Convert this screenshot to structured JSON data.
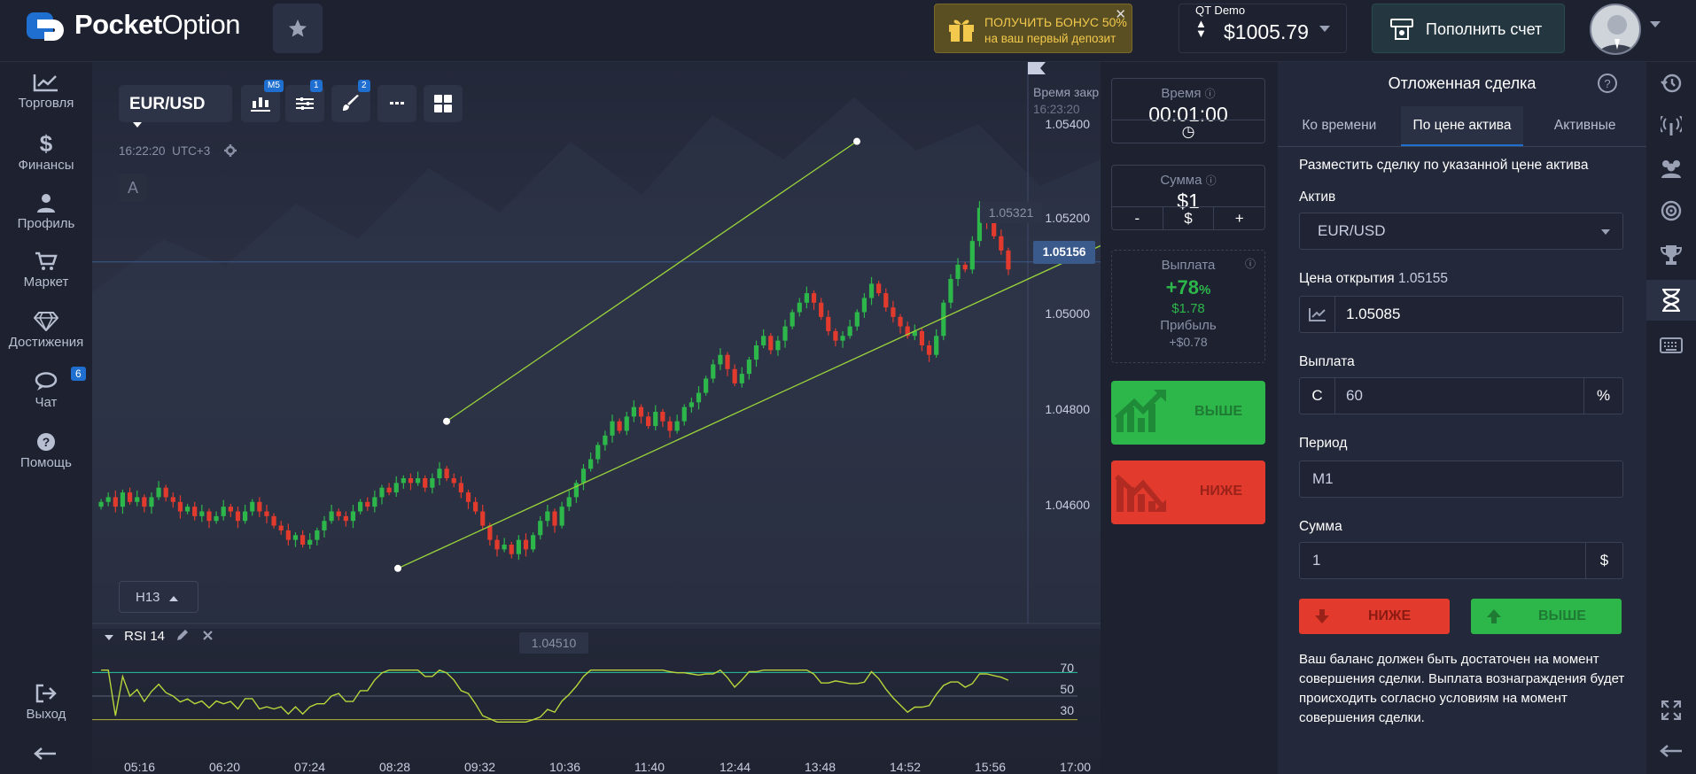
{
  "header": {
    "logo_bold": "Pocket",
    "logo_rest": "Option",
    "bonus_line1": "ПОЛУЧИТЬ БОНУС 50%",
    "bonus_line2": "на ваш первый депозит",
    "bonus_close": "✕",
    "account_type": "QT Demo",
    "balance": "$1005.79",
    "deposit_label": "Пополнить счет"
  },
  "sidebar": {
    "items": [
      {
        "label": "Торговля",
        "icon": "chart-line-icon"
      },
      {
        "label": "Финансы",
        "icon": "dollar-icon"
      },
      {
        "label": "Профиль",
        "icon": "user-icon"
      },
      {
        "label": "Маркет",
        "icon": "cart-icon"
      },
      {
        "label": "Достижения",
        "icon": "diamond-icon"
      },
      {
        "label": "Чат",
        "icon": "chat-icon",
        "badge": "6"
      },
      {
        "label": "Помощь",
        "icon": "help-icon"
      }
    ],
    "logout": "Выход"
  },
  "chart": {
    "pair": "EUR/USD",
    "timeframe_badge": "M5",
    "indicators_badge": "1",
    "drawings_badge": "2",
    "clock": "16:22:20",
    "timezone": "UTC+3",
    "a_label": "A",
    "expiry_label": "Время закр",
    "expiry_time": "16:23:20",
    "current_price": "1.05156",
    "channel_top_label": "1.05321",
    "channel_bottom_label": "1.04510",
    "price_ticks": [
      "1.05400",
      "1.05200",
      "1.05000",
      "1.04800",
      "1.04600"
    ],
    "time_ticks": [
      "05:16",
      "06:20",
      "07:24",
      "08:28",
      "09:32",
      "10:36",
      "11:40",
      "12:44",
      "13:48",
      "14:52",
      "15:56",
      "17:00"
    ],
    "period_selector": "H13",
    "rsi_label": "RSI 14",
    "rsi_levels": [
      "70",
      "50",
      "30"
    ],
    "colors": {
      "up": "#2db74b",
      "down": "#e23b2e",
      "channel": "#9ad53a",
      "rsi_line": "#b7d63b",
      "rsi_level_high": "#28c5a0",
      "rsi_level_low": "#b7b43b"
    }
  },
  "chart_data": {
    "type": "candlestick",
    "pair": "EUR/USD",
    "time_axis": [
      "05:16",
      "06:20",
      "07:24",
      "08:28",
      "09:32",
      "10:36",
      "11:40",
      "12:44",
      "13:48",
      "14:52",
      "15:56",
      "17:00"
    ],
    "price_axis": [
      1.046,
      1.048,
      1.05,
      1.052,
      1.054
    ],
    "ylim": [
      1.0442,
      1.0554
    ],
    "current_price": 1.05156,
    "closes": [
      1.0465,
      1.0466,
      1.0464,
      1.0467,
      1.0465,
      1.0466,
      1.0464,
      1.0466,
      1.0468,
      1.0466,
      1.0465,
      1.0463,
      1.0464,
      1.0462,
      1.0463,
      1.0461,
      1.0462,
      1.0464,
      1.0463,
      1.0461,
      1.0463,
      1.0465,
      1.0463,
      1.0462,
      1.046,
      1.0459,
      1.0457,
      1.0458,
      1.0456,
      1.0457,
      1.0459,
      1.0461,
      1.0463,
      1.0462,
      1.0461,
      1.0463,
      1.0465,
      1.0464,
      1.0466,
      1.0468,
      1.0467,
      1.0469,
      1.047,
      1.0469,
      1.047,
      1.0468,
      1.047,
      1.0472,
      1.047,
      1.0469,
      1.0467,
      1.0465,
      1.0463,
      1.046,
      1.0457,
      1.0455,
      1.0456,
      1.0454,
      1.0457,
      1.0455,
      1.0458,
      1.0461,
      1.0463,
      1.046,
      1.0464,
      1.0466,
      1.0469,
      1.0472,
      1.0474,
      1.0477,
      1.0479,
      1.0482,
      1.048,
      1.0483,
      1.0485,
      1.0483,
      1.0481,
      1.0484,
      1.0482,
      1.048,
      1.0482,
      1.0485,
      1.0486,
      1.0488,
      1.0491,
      1.0494,
      1.0496,
      1.0493,
      1.049,
      1.0492,
      1.0495,
      1.0498,
      1.05,
      1.0497,
      1.0499,
      1.0502,
      1.0505,
      1.0507,
      1.0509,
      1.0507,
      1.0504,
      1.0501,
      1.0499,
      1.05,
      1.0502,
      1.0505,
      1.0508,
      1.0511,
      1.0509,
      1.0506,
      1.0504,
      1.0502,
      1.05,
      1.0501,
      1.0498,
      1.0496,
      1.05,
      1.0507,
      1.0512,
      1.0515,
      1.0514,
      1.052,
      1.0527,
      1.0524,
      1.0521,
      1.0518,
      1.0514
    ],
    "rsi": {
      "period": 14,
      "levels": [
        70,
        50,
        30
      ]
    },
    "channel": {
      "upper": [
        [
          1.0482,
          "start"
        ],
        [
          1.0541,
          "end"
        ]
      ],
      "lower": [
        [
          1.0451,
          "start"
        ],
        [
          1.0516,
          "end"
        ]
      ]
    }
  },
  "trade": {
    "time_caption": "Время",
    "time_value": "00:01:00",
    "sum_caption": "Сумма",
    "sum_value": "$1",
    "sum_minus": "-",
    "sum_currency": "$",
    "sum_plus": "+",
    "payout_caption": "Выплата",
    "payout_percent": "+78",
    "payout_percent_sign": "%",
    "payout_amount": "$1.78",
    "profit_caption": "Прибыль",
    "profit_amount": "+$0.78",
    "up_label": "ВЫШЕ",
    "down_label": "НИЖЕ"
  },
  "pending": {
    "title": "Отложенная сделка",
    "tabs": [
      "Ко времени",
      "По цене актива",
      "Активные"
    ],
    "description": "Разместить сделку по указанной цене актива",
    "asset_label": "Актив",
    "asset_value": "EUR/USD",
    "open_price_label": "Цена открытия",
    "open_price_ref": "1.05155",
    "open_price_value": "1.05085",
    "payout_label": "Выплата",
    "payout_prefix": "C",
    "payout_value": "60",
    "payout_suffix": "%",
    "period_label": "Период",
    "period_value": "M1",
    "amount_label": "Сумма",
    "amount_value": "1",
    "amount_suffix": "$",
    "down_button": "НИЖЕ",
    "up_button": "ВЫШЕ",
    "note": "Ваш баланс должен быть достаточен на момент совершения сделки. Выплата вознаграждения будет происходить согласно условиям на момент совершения сделки."
  }
}
